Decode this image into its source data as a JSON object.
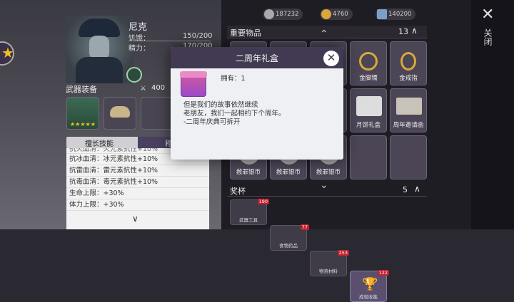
{
  "currencies": [
    "187232",
    "4760",
    "140200"
  ],
  "character": {
    "name": "尼克",
    "hunger_label": "饥饿：",
    "hunger_value": "150/200",
    "energy_label": "精力：",
    "energy_value": "170/200"
  },
  "weapon_section": {
    "title": "武器装备",
    "durability": "400"
  },
  "skill_tab": {
    "active": "擅长技能",
    "inactive": "称"
  },
  "skills": [
    "抗火血清：火元素抗性+10%",
    "抗冰血清：冰元素抗性+10%",
    "抗雷血清：雷元素抗性+10%",
    "抗毒血清：毒元素抗性+10%",
    "生命上限：+30%",
    "体力上限：+30%"
  ],
  "important_items": {
    "title": "重要物品",
    "count": "13"
  },
  "grid_labels": [
    "金脚镯",
    "金戒指",
    "月饼礼盒",
    "周年邀请函",
    "赦罪银币",
    "赦罪银币",
    "赦罪银币"
  ],
  "trophy_section": {
    "title": "奖杯",
    "count": "5"
  },
  "bottom_tabs": [
    {
      "label": "武器工具",
      "badge": "190"
    },
    {
      "label": "食物药品",
      "badge": "77"
    },
    {
      "label": "物资材料",
      "badge": "253"
    },
    {
      "label": "成就收集",
      "badge": "122"
    }
  ],
  "close_panel": {
    "label": "关闭"
  },
  "modal": {
    "title": "二周年礼盒",
    "own_label": "拥有：1",
    "description": "但是我们的故事依然继续\n老朋友，我们一起相约下个周年。\n-二周年庆典可拆开"
  }
}
